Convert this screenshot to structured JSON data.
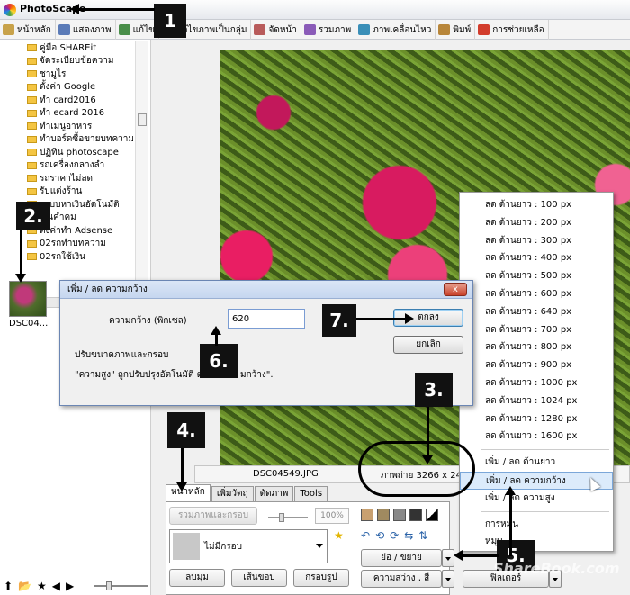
{
  "titlebar": {
    "title": "PhotoScape"
  },
  "menubar": {
    "items": [
      {
        "label": "หน้าหลัก",
        "color": "#c8a24a"
      },
      {
        "label": "แสดงภาพ",
        "color": "#5b7bb8"
      },
      {
        "label": "แก้ไข",
        "color": "#4a8f4a"
      },
      {
        "label": "แก้ไขภาพเป็นกลุ่ม",
        "color": "#4a8f4a"
      },
      {
        "label": "จัดหน้า",
        "color": "#b85b5b"
      },
      {
        "label": "รวมภาพ",
        "color": "#8a5bb8"
      },
      {
        "label": "ภาพเคลื่อนไหว",
        "color": "#3a8fb8"
      },
      {
        "label": "พิมพ์",
        "color": "#b8863a"
      },
      {
        "label": "การช่วยเหลือ",
        "color": "#d23c2c"
      }
    ]
  },
  "tree": {
    "items": [
      "คู่มือ SHAREit",
      "จัดระเบียบข้อความ",
      "ชามูไร",
      "ตั้งค่า Google",
      "ทำ card2016",
      "ทำ ecard 2016",
      "ทำเมนูอาหาร",
      "ทำบอร์ดซื้อขายบทความ",
      "ปฏิทิน photoscape",
      "รถเครื่องกลางลำ",
      "รถราคาไม่ลด",
      "รับแต่งร้าน",
      "ระบบหาเงินอัตโนมัติ",
      "เงินคำคม",
      "ตั้งค่าทำ Adsense",
      "02รถทำบทความ",
      "02รถใช้เงิน"
    ]
  },
  "thumbnail": {
    "label": "DSC04..."
  },
  "context_menu": {
    "size_items": [
      "ลด ด้านยาว : 100 px",
      "ลด ด้านยาว : 200 px",
      "ลด ด้านยาว : 300 px",
      "ลด ด้านยาว : 400 px",
      "ลด ด้านยาว : 500 px",
      "ลด ด้านยาว : 600 px",
      "ลด ด้านยาว : 640 px",
      "ลด ด้านยาว : 700 px",
      "ลด ด้านยาว : 800 px",
      "ลด ด้านยาว : 900 px",
      "ลด ด้านยาว : 1000 px",
      "ลด ด้านยาว : 1024 px",
      "ลด ด้านยาว : 1280 px",
      "ลด ด้านยาว : 1600 px"
    ],
    "option_items": [
      "เพิ่ม / ลด ด้านยาว",
      "เพิ่ม / ลด ความกว้าง",
      "เพิ่ม / ลด ความสูง"
    ],
    "extra_items": [
      "การหมุน",
      "หมุน"
    ]
  },
  "dialog": {
    "title": "เพิ่ม / ลด ความกว้าง",
    "close": "x",
    "width_label": "ความกว้าง (พิกเซล)",
    "width_value": "620",
    "ok": "ตกลง",
    "cancel": "ยกเลิก",
    "line1": "ปรับขนาดภาพและกรอบ",
    "line2": "\"ความสูง\" ถูกปรับปรุงอัตโนมัติ ต",
    "line2_end": "มกว้าง\"."
  },
  "status": {
    "filename": "DSC04549.JPG",
    "dimension": "ภาพถ่าย 3266 x 24"
  },
  "tabs": [
    "หน้าหลัก",
    "เพิ่มวัตถุ",
    "ตัดภาพ",
    "Tools"
  ],
  "panel": {
    "merge_button": "รวมภาพและกรอบ",
    "percent": "100%",
    "frame_label": "ไม่มีกรอบ",
    "round_button": "ลบมุม",
    "border_button": "เส้นขอบ",
    "frame_round_button": "กรอบรูป",
    "resize_button": "ย่อ / ขยาย",
    "brightness_button": "ความสว่าง , สี",
    "filter_button": "ฟิลเตอร์"
  },
  "callouts": {
    "c1": "1",
    "c2": "2.",
    "c3": "3.",
    "c4": "4.",
    "c5": "5.",
    "c6": "6.",
    "c7": "7."
  },
  "watermark": "ShareBook.com"
}
